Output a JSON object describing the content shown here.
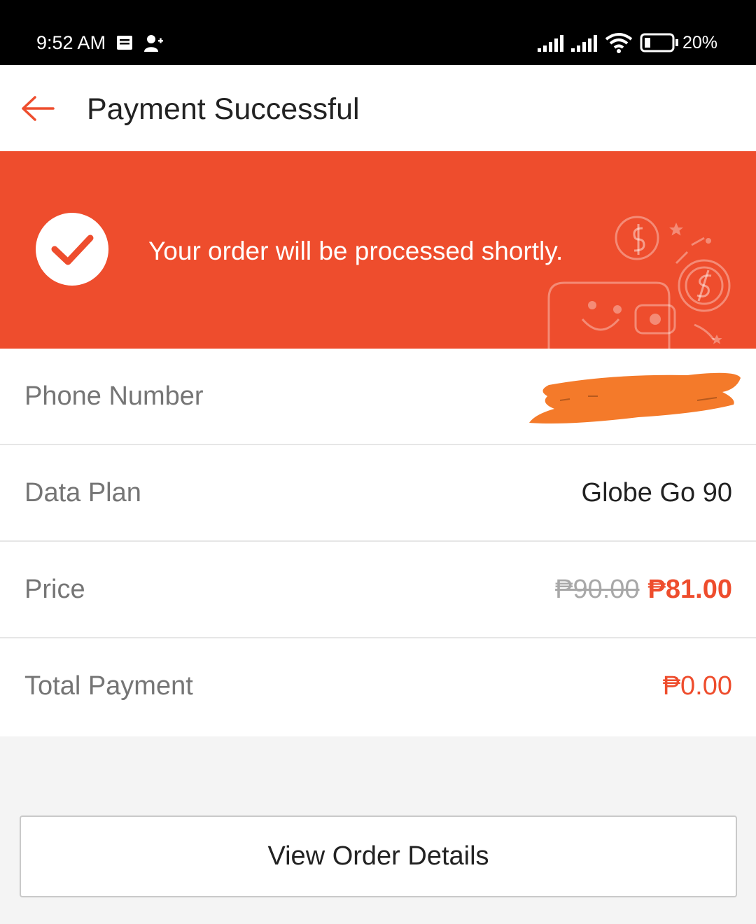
{
  "status_bar": {
    "time": "9:52 AM",
    "battery": "20%",
    "icons": [
      "message-icon",
      "add-user-icon",
      "signal-icon",
      "signal-icon",
      "wifi-icon",
      "battery-icon"
    ]
  },
  "header": {
    "title": "Payment Successful",
    "back_icon": "arrow-left-icon"
  },
  "banner": {
    "message": "Your order will be processed shortly.",
    "icon": "checkmark-icon",
    "background_color": "#ee4d2d"
  },
  "details": {
    "phone": {
      "label": "Phone Number",
      "value_redacted": true
    },
    "plan": {
      "label": "Data Plan",
      "value": "Globe Go 90"
    },
    "price": {
      "label": "Price",
      "original": "₱90.00",
      "discounted": "₱81.00"
    },
    "total": {
      "label": "Total Payment",
      "value": "₱0.00"
    }
  },
  "actions": {
    "view_order_details": "View Order Details"
  },
  "colors": {
    "accent": "#ee4d2d",
    "redaction": "#f47a2a"
  }
}
